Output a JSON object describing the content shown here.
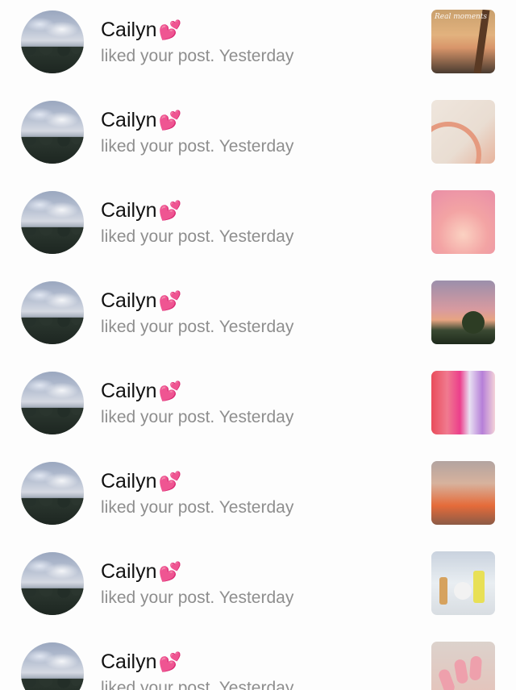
{
  "notifications": [
    {
      "user": "Cailyn",
      "emoji": "💕",
      "action": "liked your post.",
      "time": "Yesterday",
      "thumbnail": "beach-sunset-post",
      "thumb_text": "Real moments"
    },
    {
      "user": "Cailyn",
      "emoji": "💕",
      "action": "liked your post.",
      "time": "Yesterday",
      "thumbnail": "rainbow-graphic-post",
      "thumb_text": ""
    },
    {
      "user": "Cailyn",
      "emoji": "💕",
      "action": "liked your post.",
      "time": "Yesterday",
      "thumbnail": "pink-gradient-quote-post",
      "thumb_text": ""
    },
    {
      "user": "Cailyn",
      "emoji": "💕",
      "action": "liked your post.",
      "time": "Yesterday",
      "thumbnail": "sunset-sky-post",
      "thumb_text": ""
    },
    {
      "user": "Cailyn",
      "emoji": "💕",
      "action": "liked your post.",
      "time": "Yesterday",
      "thumbnail": "tumblers-store-post",
      "thumb_text": ""
    },
    {
      "user": "Cailyn",
      "emoji": "💕",
      "action": "liked your post.",
      "time": "Yesterday",
      "thumbnail": "beach-photo-post",
      "thumb_text": ""
    },
    {
      "user": "Cailyn",
      "emoji": "💕",
      "action": "liked your post.",
      "time": "Yesterday",
      "thumbnail": "skincare-products-post",
      "thumb_text": ""
    },
    {
      "user": "Cailyn",
      "emoji": "💕",
      "action": "liked your post.",
      "time": "Yesterday",
      "thumbnail": "pink-nails-post",
      "thumb_text": ""
    }
  ],
  "colors": {
    "background": "#fdfdfd",
    "username": "#111111",
    "secondary_text": "#8e8e8e",
    "heart": "#e8348f"
  }
}
